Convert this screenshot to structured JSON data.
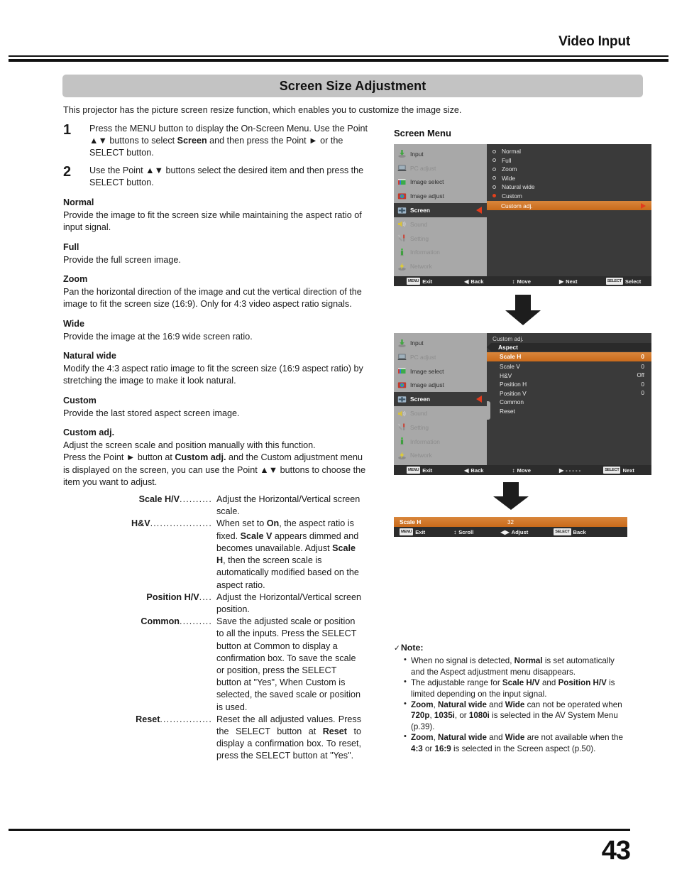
{
  "header": {
    "title": "Video Input"
  },
  "section": {
    "title": "Screen Size Adjustment",
    "intro": "This projector has the picture screen resize function, which enables you to customize the image size."
  },
  "steps": [
    {
      "num": "1",
      "text": "Press the MENU button to display the On-Screen Menu. Use the Point ▲▼ buttons to select Screen and then press the Point ► or the SELECT button."
    },
    {
      "num": "2",
      "text": "Use the Point ▲▼ buttons select the desired item and then press the SELECT button."
    }
  ],
  "definitions": [
    {
      "term": "Normal",
      "desc": "Provide the image to fit the screen size while maintaining the aspect ratio of input signal."
    },
    {
      "term": "Full",
      "desc": "Provide the full screen image."
    },
    {
      "term": "Zoom",
      "desc": "Pan the horizontal direction of the image and cut the vertical direction of the image to fit the screen size (16:9). Only for 4:3 video aspect ratio signals."
    },
    {
      "term": "Wide",
      "desc": "Provide the image at the 16:9 wide screen ratio."
    },
    {
      "term": "Natural wide",
      "desc": "Modify the 4:3 aspect ratio image to fit the screen size (16:9 aspect ratio) by stretching the image to make it look natural."
    },
    {
      "term": "Custom",
      "desc": "Provide the last stored aspect screen image."
    },
    {
      "term": "Custom adj.",
      "desc": "Adjust the screen scale and position manually with this function."
    }
  ],
  "custom_adj_para": "Press the Point ► button at Custom adj. and the Custom adjustment menu is displayed on the screen, you can use the Point ▲▼ buttons to choose the item you want to adjust.",
  "adj_items": [
    {
      "term": "Scale H/V",
      "leader": "..........",
      "desc": "Adjust the Horizontal/Vertical screen scale."
    },
    {
      "term": "H&V",
      "leader": "...................",
      "desc": "When set to On, the aspect ratio is fixed. Scale V appears dimmed and becomes unavailable. Adjust Scale H, then the screen scale is automatically modified based on the aspect ratio."
    },
    {
      "term": "Position  H/V",
      "leader": "....",
      "desc": "Adjust the Horizontal/Vertical screen position."
    },
    {
      "term": "Common",
      "leader": "..........",
      "desc": "Save the adjusted scale or position to all the inputs. Press the SELECT button at Common to display a confirmation box. To save the scale or position, press the SELECT button at \"Yes\", When Custom is selected, the saved scale or position is used."
    },
    {
      "term": "Reset",
      "leader": "................",
      "desc": "Reset the all adjusted values. Press the SELECT button at Reset to display a confirmation box. To reset, press the SELECT button at \"Yes\"."
    }
  ],
  "figure": {
    "label": "Screen Menu",
    "sidebar": [
      {
        "label": "Input",
        "icon": "input-icon",
        "state": "enabled"
      },
      {
        "label": "PC adjust",
        "icon": "pc-adjust-icon",
        "state": "dimmed"
      },
      {
        "label": "Image select",
        "icon": "image-select-icon",
        "state": "enabled"
      },
      {
        "label": "Image adjust",
        "icon": "image-adjust-icon",
        "state": "enabled"
      },
      {
        "label": "Screen",
        "icon": "screen-icon",
        "state": "active"
      },
      {
        "label": "Sound",
        "icon": "sound-icon",
        "state": "dimmed"
      },
      {
        "label": "Setting",
        "icon": "setting-icon",
        "state": "dimmed"
      },
      {
        "label": "Information",
        "icon": "information-icon",
        "state": "dimmed"
      },
      {
        "label": "Network",
        "icon": "network-icon",
        "state": "dimmed"
      }
    ],
    "aspect_options": [
      {
        "label": "Normal",
        "selected": false
      },
      {
        "label": "Full",
        "selected": false
      },
      {
        "label": "Zoom",
        "selected": false
      },
      {
        "label": "Wide",
        "selected": false
      },
      {
        "label": "Natural wide",
        "selected": false
      },
      {
        "label": "Custom",
        "selected": true
      }
    ],
    "highlight_row": "Custom adj.",
    "footer1": [
      {
        "key": "MENU",
        "label": "Exit"
      },
      {
        "glyph": "◀",
        "label": "Back"
      },
      {
        "glyph": "↕",
        "label": "Move"
      },
      {
        "glyph": "▶",
        "label": "Next"
      },
      {
        "key": "SELECT",
        "label": "Select"
      }
    ]
  },
  "figure2": {
    "sub_title": "Custom adj.",
    "sub_head": "Aspect",
    "items": [
      {
        "name": "Scale H",
        "value": "0",
        "selected": true
      },
      {
        "name": "Scale V",
        "value": "0",
        "selected": false
      },
      {
        "name": "H&V",
        "value": "Off",
        "selected": false
      },
      {
        "name": "Position H",
        "value": "0",
        "selected": false
      },
      {
        "name": "Position V",
        "value": "0",
        "selected": false
      },
      {
        "name": "Common",
        "value": "",
        "selected": false
      },
      {
        "name": "Reset",
        "value": "",
        "selected": false
      }
    ],
    "footer2": [
      {
        "key": "MENU",
        "label": "Exit"
      },
      {
        "glyph": "◀",
        "label": "Back"
      },
      {
        "glyph": "↕",
        "label": "Move"
      },
      {
        "glyph": "▶",
        "label": "- - - - -"
      },
      {
        "key": "SELECT",
        "label": "Next"
      }
    ]
  },
  "figure3": {
    "bar_label": "Scale H",
    "bar_value": "32",
    "footer3": [
      {
        "key": "MENU",
        "label": "Exit"
      },
      {
        "glyph": "↕",
        "label": "Scroll"
      },
      {
        "glyph": "◀▶",
        "label": "Adjust"
      },
      {
        "key": "SELECT",
        "label": "Back"
      }
    ]
  },
  "note": {
    "heading": "Note:",
    "check": "✓",
    "items": [
      "When no signal is detected, Normal is set automatically and the Aspect adjustment menu disappears.",
      "The adjustable range for Scale H/V and Position H/V is limited depending on the input signal.",
      "Zoom, Natural wide and Wide can not be operated when 720p, 1035i, or 1080i is selected in the AV System Menu (p.39).",
      "Zoom, Natural wide and Wide are not available when the 4:3 or 16:9 is selected in the Screen aspect (p.50)."
    ]
  },
  "footer": {
    "page_number": "43"
  },
  "colors": {
    "accent_orange": "#cf7524",
    "cursor_red": "#e23b1d",
    "osd_dark": "#3a3a3a",
    "osd_side": "#a8a8a8",
    "section_bar": "#c3c3c3"
  }
}
